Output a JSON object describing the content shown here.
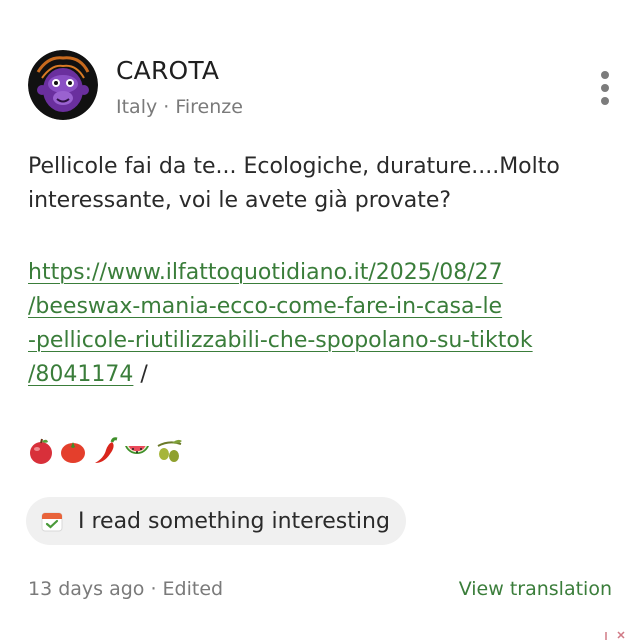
{
  "post": {
    "author": {
      "name": "CAROTA",
      "location": "Italy · Firenze",
      "avatar_icon": "purple-ape-avatar"
    },
    "more_icon": "more-vertical-icon",
    "body_lines": [
      "Pellicole fai da te... Ecologiche, durature....Molto",
      "interessante, voi le avete già provate?"
    ],
    "link_lines": [
      "https://www.ilfattoquotidiano.it/2025/08/27",
      "/beeswax-mania-ecco-come-fare-in-casa-le",
      "-pellicole-riutilizzabili-che-spopolano-su-tiktok",
      "/8041174"
    ],
    "link_trailing": " /",
    "emojis": [
      "red-apple-emoji",
      "tomato-emoji",
      "hot-pepper-emoji",
      "watermelon-emoji",
      "olive-emoji"
    ],
    "tag": {
      "icon": "calendar-check-icon",
      "label": "I read something interesting"
    },
    "meta": "13 days ago · Edited",
    "translate_label": "View translation"
  },
  "colors": {
    "link": "#3a7d3a",
    "secondary_text": "#7a7a7a",
    "chip_bg": "#f0f0f0",
    "avatar_bg": "#111111",
    "avatar_accent": "#7b3fb0"
  }
}
